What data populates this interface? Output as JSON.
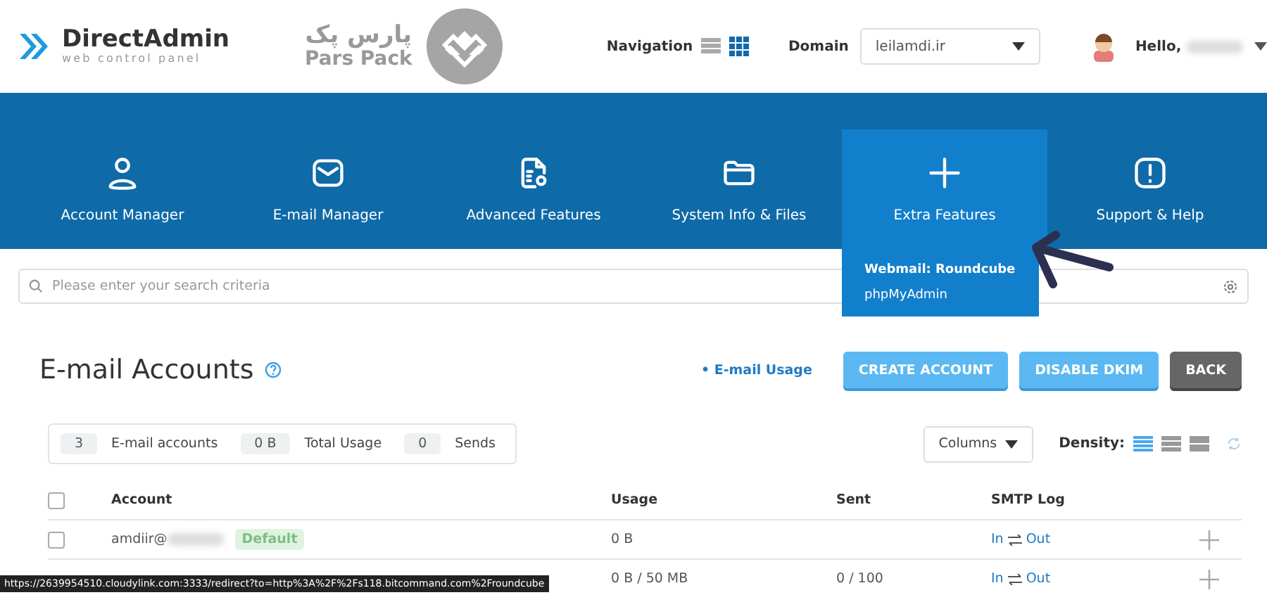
{
  "header": {
    "logo": {
      "name": "DirectAdmin",
      "tagline": "web control panel"
    },
    "partner_logo": {
      "persian": "پارس پک",
      "latin": "Pars Pack"
    },
    "navigation": {
      "label": "Navigation",
      "views": [
        {
          "kind": "list",
          "selected": false
        },
        {
          "kind": "grid",
          "selected": true
        }
      ]
    },
    "domain": {
      "label": "Domain",
      "value": "leilamdi.ir"
    },
    "user": {
      "greeting": "Hello,"
    }
  },
  "nav_items": [
    {
      "kind": "user",
      "label": "Account Manager",
      "selected": false
    },
    {
      "kind": "mail",
      "label": "E-mail Manager",
      "selected": false
    },
    {
      "kind": "doc",
      "label": "Advanced Features",
      "selected": false
    },
    {
      "kind": "folder",
      "label": "System Info & Files",
      "selected": false
    },
    {
      "kind": "plus",
      "label": "Extra Features",
      "selected": true,
      "menu": [
        {
          "label": "Webmail: Roundcube",
          "highlighted": true
        },
        {
          "label": "phpMyAdmin",
          "highlighted": false
        }
      ]
    },
    {
      "kind": "alert",
      "label": "Support & Help",
      "selected": false
    }
  ],
  "search": {
    "placeholder": "Please enter your search criteria"
  },
  "page": {
    "title": "E-mail Accounts",
    "link": "• E-mail Usage",
    "buttons": [
      {
        "label": "CREATE ACCOUNT",
        "kind": "primary"
      },
      {
        "label": "DISABLE DKIM",
        "kind": "primary"
      },
      {
        "label": "BACK",
        "kind": "dark"
      }
    ]
  },
  "stats": [
    {
      "value": "3",
      "label": "E-mail accounts"
    },
    {
      "value": "0 B",
      "label": "Total Usage"
    },
    {
      "value": "0",
      "label": "Sends"
    }
  ],
  "columns_button": "Columns",
  "density": {
    "label": "Density:",
    "options": [
      {
        "kind": "compact",
        "selected": true
      },
      {
        "kind": "normal",
        "selected": false
      },
      {
        "kind": "wide",
        "selected": false
      }
    ]
  },
  "table": {
    "all_checked": false,
    "columns": [
      "Account",
      "Usage",
      "Sent",
      "SMTP Log"
    ],
    "rows": [
      {
        "account": "amdiir@",
        "badge": "Default",
        "usage": "0 B",
        "log_in": "In",
        "log_out": "Out",
        "checked": false
      },
      {
        "usage": "0 B / 50 MB",
        "sent": "0 / 100",
        "log_in": "In",
        "log_out": "Out"
      }
    ]
  },
  "status_url": "https://2639954510.cloudylink.com:3333/redirect?to=http%3A%2F%2Fs118.bitcommand.com%2Froundcube"
}
